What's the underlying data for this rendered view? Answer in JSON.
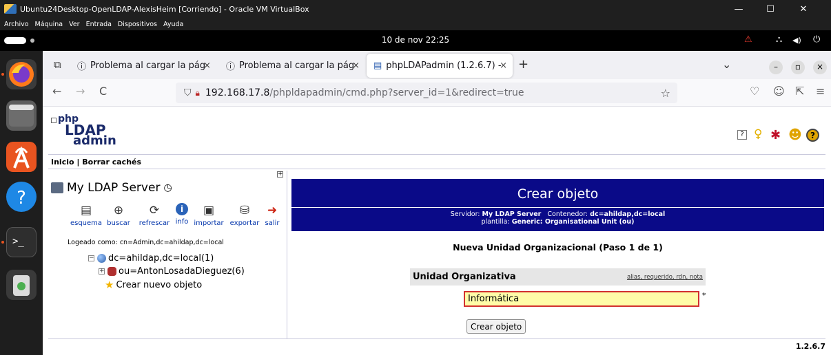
{
  "vbox": {
    "title": "Ubuntu24Desktop-OpenLDAP-AlexisHeim [Corriendo] - Oracle VM VirtualBox",
    "menu": [
      "Archivo",
      "Máquina",
      "Ver",
      "Entrada",
      "Dispositivos",
      "Ayuda"
    ],
    "controls": {
      "minimize": "—",
      "maximize": "☐",
      "close": "✕"
    }
  },
  "ubuntu": {
    "clock": "10 de nov  22:25",
    "tray": {
      "warning": "⚠",
      "network": "⛬",
      "volume": "◀)",
      "power": "⏻"
    }
  },
  "dock": {
    "icons": [
      "firefox-icon",
      "files-icon",
      "app-center-icon",
      "help-icon",
      "terminal-icon",
      "trash-icon"
    ]
  },
  "firefox": {
    "tabs": [
      {
        "icon": "ⓘ",
        "label": "Problema al cargar la pág",
        "close": "×"
      },
      {
        "icon": "ⓘ",
        "label": "Problema al cargar la pág",
        "close": "×"
      },
      {
        "icon": "▤",
        "label": "phpLDAPadmin (1.2.6.7) - ",
        "close": "×"
      }
    ],
    "new_tab": "+",
    "tab_list": "⌄",
    "url": {
      "host": "192.168.17.8",
      "path": "/phpldapadmin/cmd.php?server_id=1&redirect=true"
    },
    "nav": {
      "back": "←",
      "forward": "→",
      "reload": "C",
      "shield": "⛉",
      "lock": "🔒︎",
      "star": "☆",
      "pocket": "♡",
      "account": "☺",
      "extensions": "⇱",
      "menu": "≡"
    },
    "win": {
      "minimize": "–",
      "restore": "▫",
      "close": "×"
    }
  },
  "pla": {
    "logo": {
      "php": "php",
      "ldap": "LDAP",
      "admin": "admin"
    },
    "header_icons": {
      "help": "?",
      "idea": "♀",
      "bug": "✱",
      "smile": "☻",
      "about": "?"
    },
    "toplinks": {
      "home": "Inicio",
      "sep": "|",
      "purge": "Borrar cachés"
    },
    "server": {
      "name": "My LDAP Server",
      "clock": "◷"
    },
    "tools": [
      {
        "name": "schema",
        "icon": "▤",
        "label": "esquema"
      },
      {
        "name": "search",
        "icon": "⊕",
        "label": "buscar"
      },
      {
        "name": "refresh",
        "icon": "⟳",
        "label": "refrescar"
      },
      {
        "name": "info",
        "icon": "i",
        "label": "info"
      },
      {
        "name": "import",
        "icon": "▣",
        "label": "importar"
      },
      {
        "name": "export",
        "icon": "⛁",
        "label": "exportar"
      },
      {
        "name": "logout",
        "icon": "➜",
        "label": "salir"
      }
    ],
    "logged_in": "Logeado como: cn=Admin,dc=ahildap,dc=local",
    "tree": {
      "root": {
        "expand": "−",
        "dc_key": "dc",
        "eq": "=",
        "dc1": "ahildap",
        "comma": ", ",
        "dc_key2": "dc",
        "dc2": "local",
        "count": " (1)"
      },
      "child": {
        "expand": "+",
        "ou_key": "ou",
        "eq": "=",
        "ou": "AntonLosadaDieguez",
        "count": " (6)"
      },
      "create": "Crear nuevo objeto"
    },
    "form": {
      "title": "Crear objeto",
      "server_label": "Servidor: ",
      "server": "My LDAP Server",
      "container_label": "Contenedor: ",
      "container": "dc=ahildap,dc=local",
      "template_label": "plantilla: ",
      "template": "Generic: Organisational Unit (ou)",
      "step": "Nueva Unidad Organizacional (Paso 1 de 1)",
      "attr_name": "Unidad Organizativa",
      "attr_links": "alias, requerido, rdn, nota",
      "ou_value": "Informática",
      "required": "*",
      "submit": "Crear objeto"
    },
    "version": "1.2.6.7"
  }
}
